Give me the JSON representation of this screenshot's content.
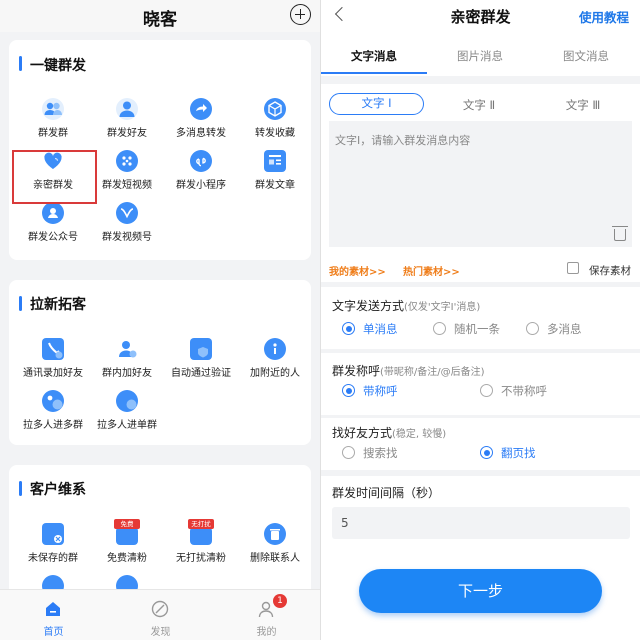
{
  "app": {
    "title": "晓客"
  },
  "sections": [
    {
      "title": "一键群发",
      "items": [
        {
          "label": "群发群",
          "icon": "group-icon",
          "color": "#3d8ef8"
        },
        {
          "label": "群发好友",
          "icon": "friends-icon",
          "color": "#3d8ef8"
        },
        {
          "label": "多消息转发",
          "icon": "forward-icon",
          "color": "#3d8ef8"
        },
        {
          "label": "转发收藏",
          "icon": "collection-cube-icon",
          "color": "#3d8ef8"
        },
        {
          "label": "亲密群发",
          "icon": "heart-icon",
          "color": "#3d8ef8"
        },
        {
          "label": "群发短视频",
          "icon": "short-video-icon",
          "color": "#3d8ef8"
        },
        {
          "label": "群发小程序",
          "icon": "mini-program-icon",
          "color": "#3d8ef8"
        },
        {
          "label": "群发文章",
          "icon": "article-icon",
          "color": "#3d8ef8"
        },
        {
          "label": "群发公众号",
          "icon": "official-account-icon",
          "color": "#3d8ef8"
        },
        {
          "label": "群发视频号",
          "icon": "video-channel-icon",
          "color": "#3d8ef8"
        }
      ]
    },
    {
      "title": "拉新拓客",
      "items": [
        {
          "label": "通讯录加好友",
          "icon": "contacts-icon",
          "color": "#3d8ef8"
        },
        {
          "label": "群内加好友",
          "icon": "add-friend-icon",
          "color": "#3d8ef8"
        },
        {
          "label": "自动通过验证",
          "icon": "verify-shield-icon",
          "color": "#3d8ef8"
        },
        {
          "label": "加附近的人",
          "icon": "location-icon",
          "color": "#3d8ef8"
        },
        {
          "label": "拉多人进多群",
          "icon": "multi-group-chat-icon",
          "color": "#3d8ef8"
        },
        {
          "label": "拉多人进单群",
          "icon": "single-group-chat-icon",
          "color": "#3d8ef8"
        }
      ]
    },
    {
      "title": "客户维系",
      "items": [
        {
          "label": "未保存的群",
          "icon": "unsaved-group-icon",
          "color": "#3d8ef8"
        },
        {
          "label": "免费清粉",
          "icon": "free-clean-icon",
          "color": "#3d8ef8",
          "tag": "免费",
          "tag_color": "#e53935"
        },
        {
          "label": "无打扰清粉",
          "icon": "quiet-clean-icon",
          "color": "#3d8ef8",
          "tag": "无打扰",
          "tag_color": "#e53935"
        },
        {
          "label": "删除联系人",
          "icon": "delete-contact-icon",
          "color": "#3d8ef8"
        }
      ]
    }
  ],
  "tabbar": [
    {
      "label": "首页",
      "icon": "home-icon",
      "active": true
    },
    {
      "label": "发现",
      "icon": "discover-icon",
      "active": false
    },
    {
      "label": "我的",
      "icon": "profile-icon",
      "active": false,
      "badge": "1"
    }
  ],
  "detail": {
    "title": "亲密群发",
    "help_link": "使用教程",
    "tabs": [
      "文字消息",
      "图片消息",
      "图文消息"
    ],
    "text_tabs": [
      "文字 Ⅰ",
      "文字 Ⅱ",
      "文字 Ⅲ"
    ],
    "placeholder": "文字Ⅰ，请输入群发消息内容",
    "my_material": "我的素材>>",
    "hot_material": "热门素材>>",
    "save_material": "保存素材",
    "send_mode": {
      "label": "文字发送方式",
      "hint": "(仅发'文字Ⅰ'消息)",
      "options": [
        "单消息",
        "随机一条",
        "多消息"
      ],
      "selected": "单消息"
    },
    "salutation": {
      "label": "群发称呼",
      "hint": "(带昵称/备注/@后备注)",
      "options": [
        "带称呼",
        "不带称呼"
      ],
      "selected": "带称呼"
    },
    "find_mode": {
      "label": "找好友方式",
      "hint": "(稳定, 较慢)",
      "options": [
        "搜索找",
        "翻页找"
      ],
      "selected": "翻页找"
    },
    "interval": {
      "label": "群发时间间隔（秒）",
      "value": "5"
    },
    "next_button": "下一步"
  },
  "colors": {
    "accent": "#2b7cf6",
    "orange": "#ef7d1a",
    "highlight": "#d93a3a",
    "badge": "#e53935"
  }
}
